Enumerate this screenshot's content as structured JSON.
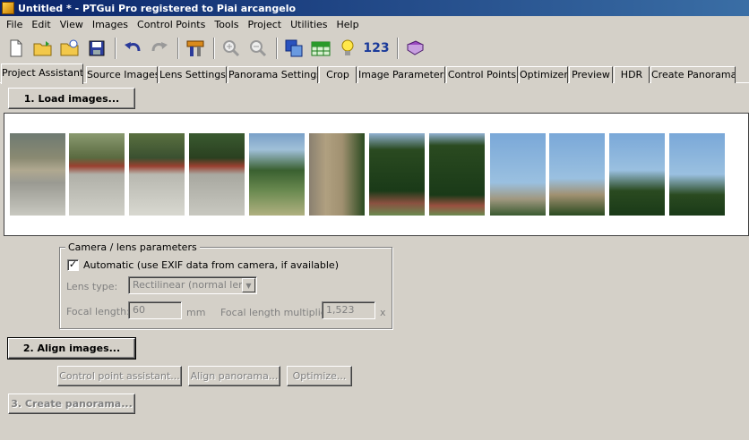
{
  "window": {
    "title": "Untitled * - PTGui Pro registered to Piai arcangelo"
  },
  "menu": [
    "File",
    "Edit",
    "View",
    "Images",
    "Control Points",
    "Tools",
    "Project",
    "Utilities",
    "Help"
  ],
  "toolbar": {
    "number_button_label": "123"
  },
  "tabs": [
    "Project Assistant",
    "Source Images",
    "Lens Settings",
    "Panorama Settings",
    "Crop",
    "Image Parameters",
    "Control Points",
    "Optimizer",
    "Preview",
    "HDR",
    "Create Panorama"
  ],
  "step1": {
    "load_label": "1. Load images..."
  },
  "camera": {
    "group_title": "Camera / lens parameters",
    "automatic_label": "Automatic (use EXIF data from camera, if available)",
    "automatic_checked": true,
    "lens_type_label": "Lens type:",
    "lens_type_value": "Rectilinear (normal lens)",
    "focal_length_label": "Focal length:",
    "focal_length_value": "60",
    "focal_length_unit": "mm",
    "multiplier_label": "Focal length multiplier:",
    "multiplier_value": "1,523",
    "multiplier_unit": "x"
  },
  "step2": {
    "align_label": "2. Align images...",
    "cp_assistant_label": "Control point assistant...",
    "align_panorama_label": "Align panorama...",
    "optimize_label": "Optimize..."
  },
  "step3": {
    "create_label": "3. Create panorama..."
  }
}
